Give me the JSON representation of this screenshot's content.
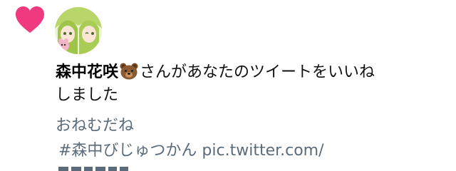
{
  "notification": {
    "type_icon": "heart-icon",
    "heart_color": "#f0397f",
    "avatar_icon": "avatar-image",
    "user_name": "森中花咲",
    "user_emoji": "bear-icon",
    "action_line1": "さんがあなたのツイートをいいね",
    "action_line2": "しました",
    "tweet_text_line1": "おねむだね",
    "tweet_text_line2": "#森中びじゅつかん pic.twitter.com/"
  }
}
